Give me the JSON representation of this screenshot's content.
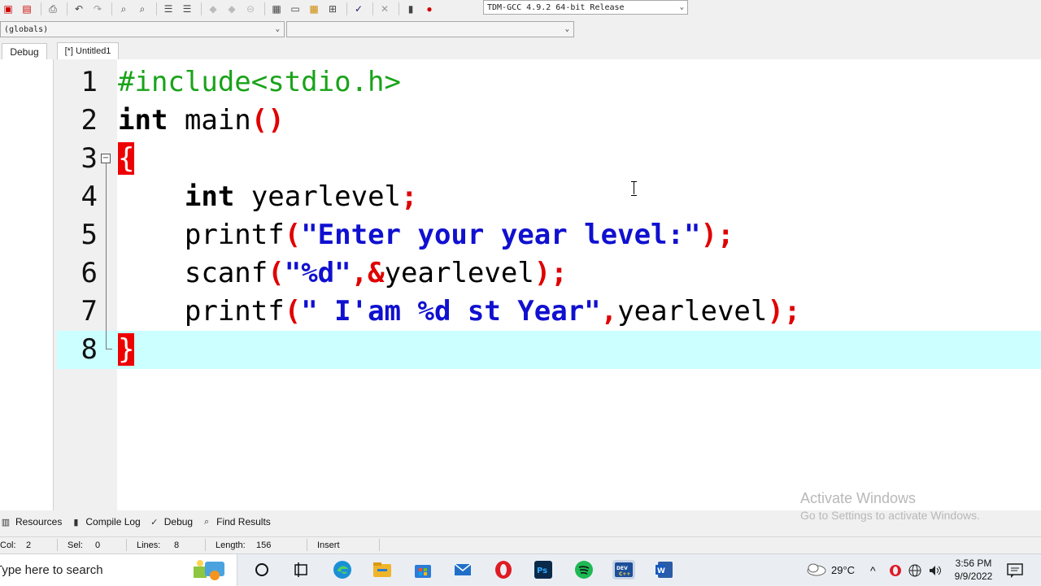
{
  "toolbar": {
    "compiler": "TDM-GCC 4.9.2 64-bit Release",
    "icons": [
      "project-icon",
      "class-icon",
      "print-icon",
      "undo-icon",
      "redo-icon",
      "find-icon",
      "replace-icon",
      "indent-icon",
      "unindent-icon",
      "bookmark-prev-icon",
      "bookmark-next-icon",
      "goto-icon",
      "new-window-icon",
      "full-screen-icon",
      "grid-icon",
      "tiles-icon",
      "check-icon",
      "close-icon",
      "chart-icon",
      "profile-icon"
    ]
  },
  "scope": {
    "left_value": "(globals)",
    "right_value": ""
  },
  "left_panel": {
    "tab_label": "Debug"
  },
  "editor": {
    "tab_label": "[*] Untitled1",
    "active_line": 8,
    "lines": [
      {
        "num": "1",
        "tokens": [
          {
            "t": "#include<stdio.h>",
            "c": "pp"
          }
        ]
      },
      {
        "num": "2",
        "tokens": [
          {
            "t": "int",
            "c": "kw"
          },
          {
            "t": " main",
            "c": "id"
          },
          {
            "t": "()",
            "c": "sym"
          }
        ]
      },
      {
        "num": "3",
        "tokens": [
          {
            "t": "{",
            "c": "brace"
          }
        ]
      },
      {
        "num": "4",
        "tokens": [
          {
            "t": "    ",
            "c": "id"
          },
          {
            "t": "int",
            "c": "kw"
          },
          {
            "t": " yearlevel",
            "c": "id"
          },
          {
            "t": ";",
            "c": "sym"
          }
        ]
      },
      {
        "num": "5",
        "tokens": [
          {
            "t": "    printf",
            "c": "id"
          },
          {
            "t": "(",
            "c": "sym"
          },
          {
            "t": "\"Enter your year level:\"",
            "c": "str"
          },
          {
            "t": ");",
            "c": "sym"
          }
        ]
      },
      {
        "num": "6",
        "tokens": [
          {
            "t": "    scanf",
            "c": "id"
          },
          {
            "t": "(",
            "c": "sym"
          },
          {
            "t": "\"%d\"",
            "c": "str"
          },
          {
            "t": ",&",
            "c": "sym"
          },
          {
            "t": "yearlevel",
            "c": "id"
          },
          {
            "t": ");",
            "c": "sym"
          }
        ]
      },
      {
        "num": "7",
        "tokens": [
          {
            "t": "    printf",
            "c": "id"
          },
          {
            "t": "(",
            "c": "sym"
          },
          {
            "t": "\" I'am %d st Year\"",
            "c": "str"
          },
          {
            "t": ",",
            "c": "sym"
          },
          {
            "t": "yearlevel",
            "c": "id"
          },
          {
            "t": ");",
            "c": "sym"
          }
        ]
      },
      {
        "num": "8",
        "tokens": [
          {
            "t": "}",
            "c": "brace"
          }
        ]
      }
    ]
  },
  "watermark": {
    "line1": "Activate Windows",
    "line2": "Go to Settings to activate Windows."
  },
  "bottom_tabs": [
    {
      "label": "Resources",
      "icon": "resources-icon"
    },
    {
      "label": "Compile Log",
      "icon": "compile-log-icon"
    },
    {
      "label": "Debug",
      "icon": "debug-icon"
    },
    {
      "label": "Find Results",
      "icon": "find-results-icon"
    }
  ],
  "status": {
    "col_label": "Col:",
    "col_value": "2",
    "sel_label": "Sel:",
    "sel_value": "0",
    "lines_label": "Lines:",
    "lines_value": "8",
    "length_label": "Length:",
    "length_value": "156",
    "mode": "Insert"
  },
  "taskbar": {
    "search_placeholder": "Type here to search",
    "temperature": "29°C",
    "time": "3:56 PM",
    "date": "9/9/2022",
    "apps": [
      "cortana-icon",
      "task-view-icon",
      "edge-icon",
      "file-explorer-icon",
      "store-icon",
      "mail-icon",
      "opera-icon",
      "photoshop-icon",
      "spotify-icon",
      "devcpp-icon",
      "word-icon"
    ],
    "colors": {
      "edge": "#1b8fd6",
      "explorer": "#f0b429",
      "store": "#2d7bd8",
      "mail": "#1f6fc9",
      "opera": "#e01b24",
      "photoshop": "#0a2a4a",
      "spotify": "#1db954",
      "devcpp": "#1c4f99",
      "word": "#2b5ca8"
    }
  }
}
